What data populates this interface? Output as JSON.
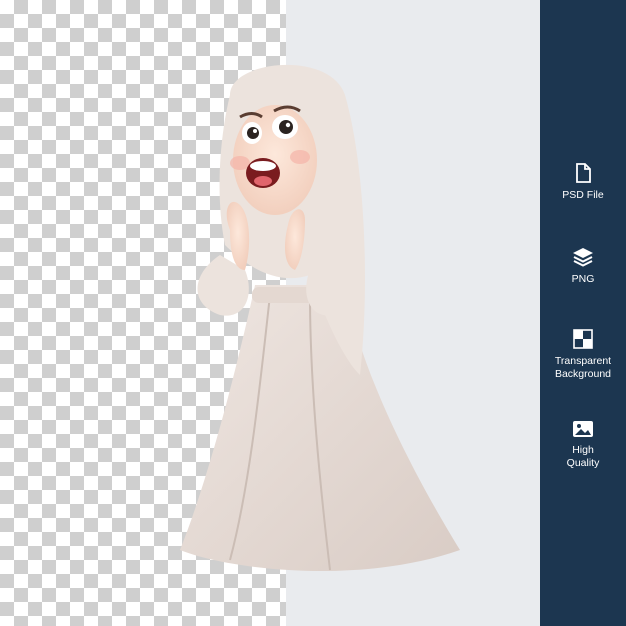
{
  "features": [
    {
      "icon": "file-icon",
      "label": "PSD File"
    },
    {
      "icon": "layers-icon",
      "label": "PNG"
    },
    {
      "icon": "transparency-icon",
      "label": "Transparent\nBackground"
    },
    {
      "icon": "image-icon",
      "label": "High\nQuality"
    }
  ],
  "colors": {
    "sidebar": "#1c3650",
    "checker_dark": "#cfcfcf",
    "right_background": "#e9ebee"
  }
}
